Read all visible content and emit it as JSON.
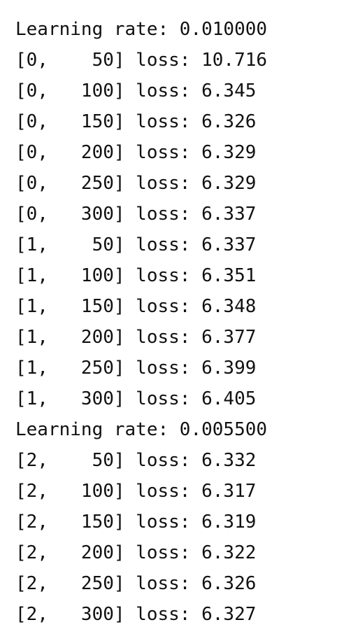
{
  "console": {
    "lines": [
      "Learning rate: 0.010000",
      "[0,    50] loss: 10.716",
      "[0,   100] loss: 6.345",
      "[0,   150] loss: 6.326",
      "[0,   200] loss: 6.329",
      "[0,   250] loss: 6.329",
      "[0,   300] loss: 6.337",
      "[1,    50] loss: 6.337",
      "[1,   100] loss: 6.351",
      "[1,   150] loss: 6.348",
      "[1,   200] loss: 6.377",
      "[1,   250] loss: 6.399",
      "[1,   300] loss: 6.405",
      "Learning rate: 0.005500",
      "[2,    50] loss: 6.332",
      "[2,   100] loss: 6.317",
      "[2,   150] loss: 6.319",
      "[2,   200] loss: 6.322",
      "[2,   250] loss: 6.326",
      "[2,   300] loss: 6.327"
    ]
  }
}
